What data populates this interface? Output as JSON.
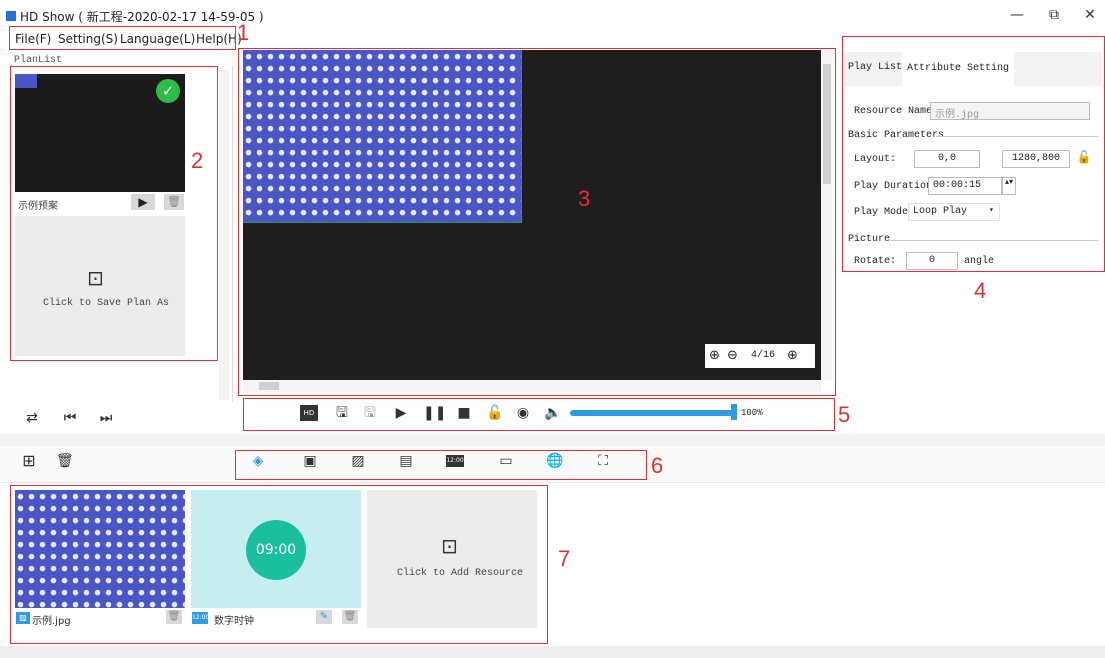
{
  "app": {
    "title": "HD Show ( 新工程-2020-02-17 14-59-05 )",
    "window_buttons": [
      "—",
      "⧉",
      "✕"
    ]
  },
  "menu": {
    "items": [
      "File(F)",
      "Setting(S)",
      "Language(L)",
      "Help(H)"
    ]
  },
  "annotations": [
    "1",
    "2",
    "3",
    "4",
    "5",
    "6",
    "7"
  ],
  "planlist": {
    "label": "PlanList",
    "plan_name": "示例预案",
    "save_label": "Click to Save Plan As"
  },
  "preview": {
    "zoom_text": "4/16"
  },
  "attributes": {
    "tabs": [
      "Play List",
      "Attribute Setting"
    ],
    "resource_name_label": "Resource Name:",
    "resource_name_value": "示例.jpg",
    "basic_parameters": "Basic Parameters",
    "layout_label": "Layout:",
    "layout_pos": "0,0",
    "layout_size": "1280,800",
    "duration_label": "Play Duration:",
    "duration_value": "00:00:15",
    "mode_label": "Play Mode:",
    "mode_value": "Loop Play",
    "picture_label": "Picture",
    "rotate_label": "Rotate:",
    "rotate_value": "0",
    "rotate_unit": "angle"
  },
  "controls": {
    "volume_value": "100%",
    "volume_fraction": 1.0
  },
  "resources": {
    "items": [
      {
        "name": "示例.jpg",
        "type": "image"
      },
      {
        "name": "数字时钟",
        "type": "clock",
        "clock_text": "09:00"
      }
    ],
    "add_label": "Click to Add Resource"
  },
  "colors": {
    "accent": "#2f9be0",
    "annotation_red": "#e03030",
    "clock_teal": "#1bbfa0",
    "pattern_blue": "#4a56c6"
  }
}
